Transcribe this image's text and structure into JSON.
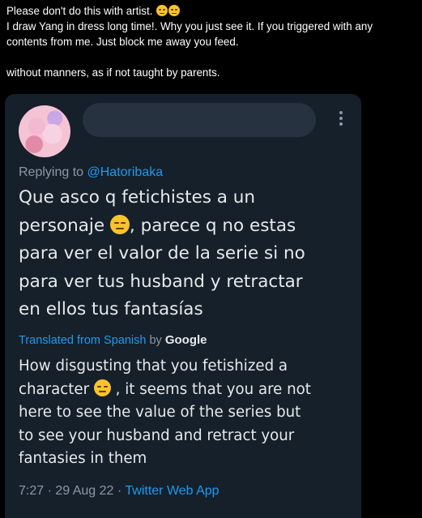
{
  "caption": {
    "line1": "Please don't do this with artist.",
    "line2": "I draw Yang in dress long time!. Why you just see it. If you triggered with any",
    "line3": "contents from me. Just block me away you feed.",
    "line4": "without manners, as if not taught by parents."
  },
  "reply": {
    "replying_prefix": "Replying to",
    "replying_handle": "@Hatoribaka"
  },
  "tweet": {
    "line1": "Que asco q fetichistes a un",
    "line2_a": "personaje",
    "line2_b": ", parece q no estas",
    "line3": "para ver el valor de la serie si no",
    "line4": "para ver tus husband y retractar",
    "line5": "en ellos tus fantasías"
  },
  "translation_bar": {
    "label": "Translated from Spanish",
    "by": "by",
    "brand": "Google"
  },
  "translation": {
    "line1": "How disgusting that you fetishized a",
    "line2_a": "character",
    "line2_b": " , it seems that you are not",
    "line3": "here to see the value of the series but",
    "line4": "to see your husband and retract your",
    "line5": "fantasies in them"
  },
  "meta": {
    "time": "7:27",
    "sep1": " · ",
    "date": "29 Aug 22",
    "sep2": " · ",
    "app": "Twitter Web App"
  },
  "icons": {
    "emoji": "unamused-face-icon",
    "more": "more-vertical-icon"
  },
  "colors": {
    "background": "#000000",
    "card": "#15202b",
    "accent": "#1d9bf0",
    "muted": "#8b98a5",
    "text": "#e7e9ea"
  }
}
